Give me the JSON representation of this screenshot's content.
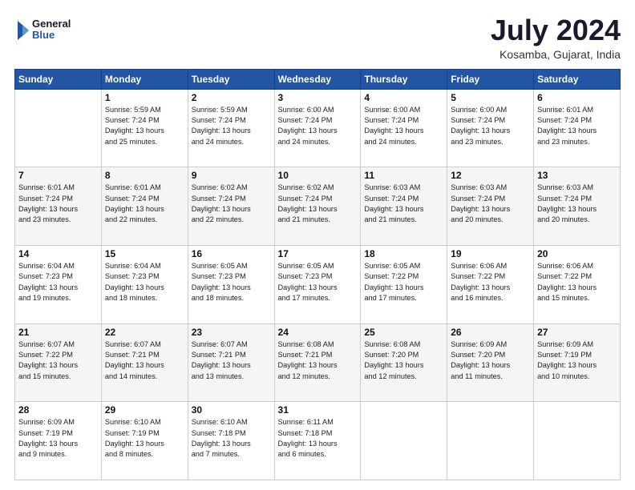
{
  "logo": {
    "line1": "General",
    "line2": "Blue"
  },
  "title": "July 2024",
  "location": "Kosamba, Gujarat, India",
  "weekdays": [
    "Sunday",
    "Monday",
    "Tuesday",
    "Wednesday",
    "Thursday",
    "Friday",
    "Saturday"
  ],
  "weeks": [
    [
      {
        "day": "",
        "info": ""
      },
      {
        "day": "1",
        "info": "Sunrise: 5:59 AM\nSunset: 7:24 PM\nDaylight: 13 hours\nand 25 minutes."
      },
      {
        "day": "2",
        "info": "Sunrise: 5:59 AM\nSunset: 7:24 PM\nDaylight: 13 hours\nand 24 minutes."
      },
      {
        "day": "3",
        "info": "Sunrise: 6:00 AM\nSunset: 7:24 PM\nDaylight: 13 hours\nand 24 minutes."
      },
      {
        "day": "4",
        "info": "Sunrise: 6:00 AM\nSunset: 7:24 PM\nDaylight: 13 hours\nand 24 minutes."
      },
      {
        "day": "5",
        "info": "Sunrise: 6:00 AM\nSunset: 7:24 PM\nDaylight: 13 hours\nand 23 minutes."
      },
      {
        "day": "6",
        "info": "Sunrise: 6:01 AM\nSunset: 7:24 PM\nDaylight: 13 hours\nand 23 minutes."
      }
    ],
    [
      {
        "day": "7",
        "info": "Sunrise: 6:01 AM\nSunset: 7:24 PM\nDaylight: 13 hours\nand 23 minutes."
      },
      {
        "day": "8",
        "info": "Sunrise: 6:01 AM\nSunset: 7:24 PM\nDaylight: 13 hours\nand 22 minutes."
      },
      {
        "day": "9",
        "info": "Sunrise: 6:02 AM\nSunset: 7:24 PM\nDaylight: 13 hours\nand 22 minutes."
      },
      {
        "day": "10",
        "info": "Sunrise: 6:02 AM\nSunset: 7:24 PM\nDaylight: 13 hours\nand 21 minutes."
      },
      {
        "day": "11",
        "info": "Sunrise: 6:03 AM\nSunset: 7:24 PM\nDaylight: 13 hours\nand 21 minutes."
      },
      {
        "day": "12",
        "info": "Sunrise: 6:03 AM\nSunset: 7:24 PM\nDaylight: 13 hours\nand 20 minutes."
      },
      {
        "day": "13",
        "info": "Sunrise: 6:03 AM\nSunset: 7:24 PM\nDaylight: 13 hours\nand 20 minutes."
      }
    ],
    [
      {
        "day": "14",
        "info": "Sunrise: 6:04 AM\nSunset: 7:23 PM\nDaylight: 13 hours\nand 19 minutes."
      },
      {
        "day": "15",
        "info": "Sunrise: 6:04 AM\nSunset: 7:23 PM\nDaylight: 13 hours\nand 18 minutes."
      },
      {
        "day": "16",
        "info": "Sunrise: 6:05 AM\nSunset: 7:23 PM\nDaylight: 13 hours\nand 18 minutes."
      },
      {
        "day": "17",
        "info": "Sunrise: 6:05 AM\nSunset: 7:23 PM\nDaylight: 13 hours\nand 17 minutes."
      },
      {
        "day": "18",
        "info": "Sunrise: 6:05 AM\nSunset: 7:22 PM\nDaylight: 13 hours\nand 17 minutes."
      },
      {
        "day": "19",
        "info": "Sunrise: 6:06 AM\nSunset: 7:22 PM\nDaylight: 13 hours\nand 16 minutes."
      },
      {
        "day": "20",
        "info": "Sunrise: 6:06 AM\nSunset: 7:22 PM\nDaylight: 13 hours\nand 15 minutes."
      }
    ],
    [
      {
        "day": "21",
        "info": "Sunrise: 6:07 AM\nSunset: 7:22 PM\nDaylight: 13 hours\nand 15 minutes."
      },
      {
        "day": "22",
        "info": "Sunrise: 6:07 AM\nSunset: 7:21 PM\nDaylight: 13 hours\nand 14 minutes."
      },
      {
        "day": "23",
        "info": "Sunrise: 6:07 AM\nSunset: 7:21 PM\nDaylight: 13 hours\nand 13 minutes."
      },
      {
        "day": "24",
        "info": "Sunrise: 6:08 AM\nSunset: 7:21 PM\nDaylight: 13 hours\nand 12 minutes."
      },
      {
        "day": "25",
        "info": "Sunrise: 6:08 AM\nSunset: 7:20 PM\nDaylight: 13 hours\nand 12 minutes."
      },
      {
        "day": "26",
        "info": "Sunrise: 6:09 AM\nSunset: 7:20 PM\nDaylight: 13 hours\nand 11 minutes."
      },
      {
        "day": "27",
        "info": "Sunrise: 6:09 AM\nSunset: 7:19 PM\nDaylight: 13 hours\nand 10 minutes."
      }
    ],
    [
      {
        "day": "28",
        "info": "Sunrise: 6:09 AM\nSunset: 7:19 PM\nDaylight: 13 hours\nand 9 minutes."
      },
      {
        "day": "29",
        "info": "Sunrise: 6:10 AM\nSunset: 7:19 PM\nDaylight: 13 hours\nand 8 minutes."
      },
      {
        "day": "30",
        "info": "Sunrise: 6:10 AM\nSunset: 7:18 PM\nDaylight: 13 hours\nand 7 minutes."
      },
      {
        "day": "31",
        "info": "Sunrise: 6:11 AM\nSunset: 7:18 PM\nDaylight: 13 hours\nand 6 minutes."
      },
      {
        "day": "",
        "info": ""
      },
      {
        "day": "",
        "info": ""
      },
      {
        "day": "",
        "info": ""
      }
    ]
  ]
}
